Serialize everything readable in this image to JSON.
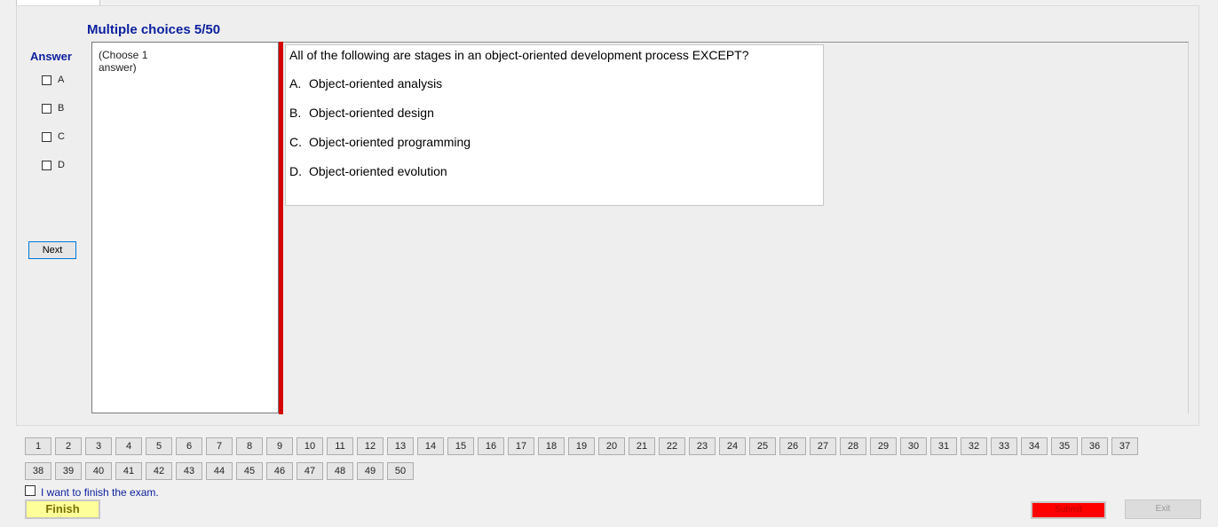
{
  "header": {
    "section_title": "Multiple choices 5/50"
  },
  "answer_panel": {
    "heading": "Answer",
    "choices": [
      {
        "label": "A",
        "checked": false
      },
      {
        "label": "B",
        "checked": false
      },
      {
        "label": "C",
        "checked": false
      },
      {
        "label": "D",
        "checked": false
      }
    ],
    "next_label": "Next"
  },
  "instruction": {
    "text": "(Choose 1 answer)"
  },
  "question": {
    "text": "All of the following are stages in an object-oriented development process EXCEPT?",
    "options": [
      {
        "letter": "A.",
        "text": "Object-oriented analysis"
      },
      {
        "letter": "B.",
        "text": "Object-oriented design"
      },
      {
        "letter": "C.",
        "text": "Object-oriented programming"
      },
      {
        "letter": "D.",
        "text": "Object-oriented evolution"
      }
    ]
  },
  "navigation": {
    "question_numbers": [
      "1",
      "2",
      "3",
      "4",
      "5",
      "6",
      "7",
      "8",
      "9",
      "10",
      "11",
      "12",
      "13",
      "14",
      "15",
      "16",
      "17",
      "18",
      "19",
      "20",
      "21",
      "22",
      "23",
      "24",
      "25",
      "26",
      "27",
      "28",
      "29",
      "30",
      "31",
      "32",
      "33",
      "34",
      "35",
      "36",
      "37",
      "38",
      "39",
      "40",
      "41",
      "42",
      "43",
      "44",
      "45",
      "46",
      "47",
      "48",
      "49",
      "50"
    ]
  },
  "footer": {
    "finish_checkbox_label": "I want to finish the exam.",
    "finish_label": "Finish",
    "submit_label": "Submit",
    "exit_label": "Exit"
  },
  "colors": {
    "accent_blue": "#0b1f9e",
    "divider_red": "#d40000",
    "finish_yellow": "#ffff99",
    "submit_red": "#ff0000"
  }
}
